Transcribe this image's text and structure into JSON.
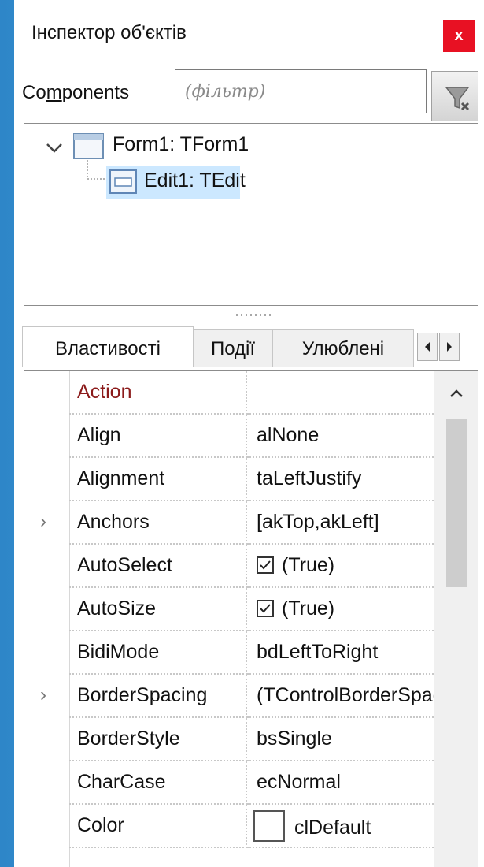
{
  "window": {
    "title": "Інспектор об'єктів",
    "close_label": "x"
  },
  "components": {
    "label_before": "Co",
    "label_underlined": "m",
    "label_after": "ponents",
    "filter_placeholder": "(фільтр)"
  },
  "tree": {
    "nodes": [
      {
        "label": "Form1: TForm1",
        "expanded": true
      },
      {
        "label": "Edit1: TEdit",
        "selected": true
      }
    ]
  },
  "tabs": [
    {
      "label": "Властивості",
      "active": true
    },
    {
      "label": "Події",
      "active": false
    },
    {
      "label": "Улюблені",
      "active": false
    }
  ],
  "properties": [
    {
      "name": "Action",
      "value": ""
    },
    {
      "name": "Align",
      "value": "alNone"
    },
    {
      "name": "Alignment",
      "value": "taLeftJustify"
    },
    {
      "name": "Anchors",
      "value": "[akTop,akLeft]",
      "expandable": true
    },
    {
      "name": "AutoSelect",
      "value": "(True)",
      "checkbox": true
    },
    {
      "name": "AutoSize",
      "value": "(True)",
      "checkbox": true
    },
    {
      "name": "BidiMode",
      "value": "bdLeftToRight"
    },
    {
      "name": "BorderSpacing",
      "value": "(TControlBorderSpacing)",
      "expandable": true
    },
    {
      "name": "BorderStyle",
      "value": "bsSingle"
    },
    {
      "name": "CharCase",
      "value": "ecNormal"
    },
    {
      "name": "Color",
      "value": "clDefault",
      "colorbox": true
    }
  ],
  "colors": {
    "close_red": "#e81123",
    "selection": "#cce8ff",
    "highlight_prop": "#8b1a1a",
    "desktop_blue": "#2e86c8"
  }
}
